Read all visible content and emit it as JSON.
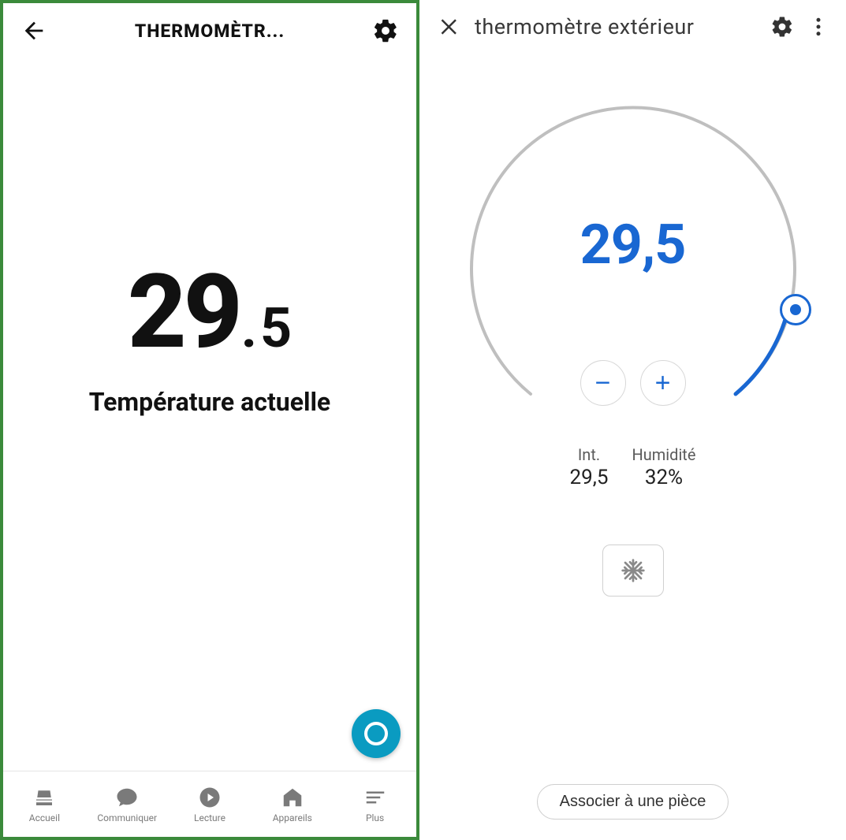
{
  "left": {
    "header_title": "THERMOMÈTR...",
    "temp_int": "29",
    "temp_sep": ".",
    "temp_frac": "5",
    "temp_label": "Température actuelle",
    "nav": {
      "home": "Accueil",
      "communicate": "Communiquer",
      "play": "Lecture",
      "devices": "Appareils",
      "more": "Plus"
    }
  },
  "right": {
    "header_title": "thermomètre extérieur",
    "dial_temp": "29,5",
    "minus": "−",
    "plus": "+",
    "stat_int_label": "Int.",
    "stat_int_value": "29,5",
    "stat_hum_label": "Humidité",
    "stat_hum_value": "32%",
    "assoc_label": "Associer à une pièce"
  }
}
